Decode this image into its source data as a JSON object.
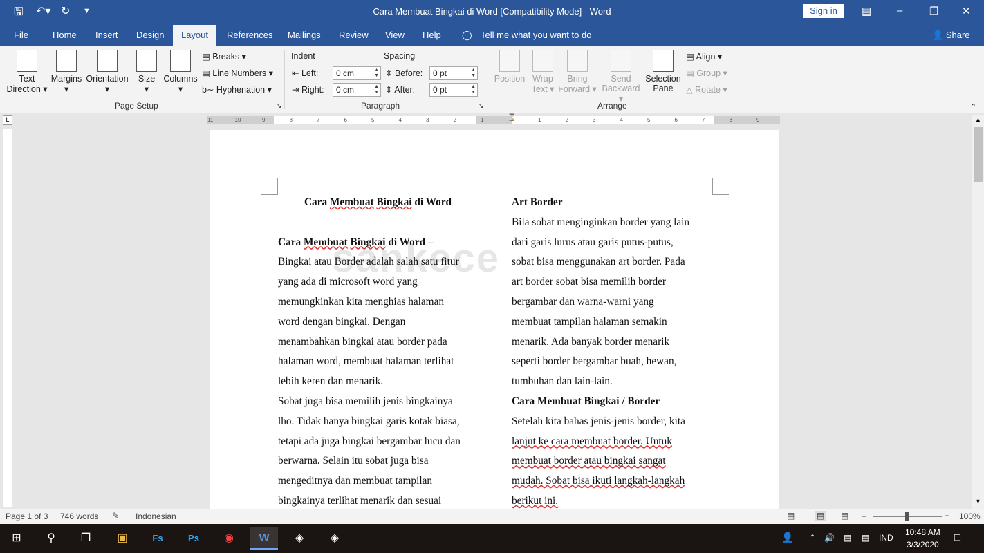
{
  "titlebar": {
    "title": "Cara Membuat Bingkai di Word [Compatibility Mode]  -  Word",
    "signin": "Sign in"
  },
  "menu": {
    "tabs": [
      "File",
      "Home",
      "Insert",
      "Design",
      "Layout",
      "References",
      "Mailings",
      "Review",
      "View",
      "Help"
    ],
    "tellme": "Tell me what you want to do",
    "share": "Share"
  },
  "ribbon": {
    "page_setup": {
      "text_direction": [
        "Text",
        "Direction"
      ],
      "margins": "Margins",
      "orientation": "Orientation",
      "size": "Size",
      "columns": "Columns",
      "breaks": "Breaks",
      "line_numbers": "Line Numbers",
      "hyphenation": "Hyphenation",
      "group": "Page Setup"
    },
    "paragraph": {
      "indent": "Indent",
      "spacing": "Spacing",
      "left_label": "Left:",
      "left_value": "0 cm",
      "right_label": "Right:",
      "right_value": "0 cm",
      "before_label": "Before:",
      "before_value": "0 pt",
      "after_label": "After:",
      "after_value": "0 pt",
      "group": "Paragraph"
    },
    "arrange": {
      "position": "Position",
      "wrap": [
        "Wrap",
        "Text"
      ],
      "bring": [
        "Bring",
        "Forward"
      ],
      "send": [
        "Send",
        "Backward"
      ],
      "selection": [
        "Selection",
        "Pane"
      ],
      "align": "Align",
      "group_btn": "Group",
      "rotate": "Rotate",
      "group": "Arrange"
    }
  },
  "ruler": {
    "labels": [
      "11",
      "10",
      "9",
      "8",
      "7",
      "6",
      "5",
      "4",
      "3",
      "2",
      "1",
      "1",
      "2",
      "3",
      "4",
      "5",
      "6",
      "7",
      "8",
      "9"
    ]
  },
  "doc": {
    "left": {
      "title": [
        "Cara ",
        "Membuat",
        " ",
        "Bingkai",
        " di Word"
      ],
      "lines": [
        [
          "Cara ",
          "Membuat",
          " ",
          "Bingkai",
          " di Word –"
        ],
        "Bingkai atau Border adalah salah satu fitur",
        "yang ada di microsoft word yang",
        "memungkinkan kita menghias halaman",
        "word dengan bingkai. Dengan",
        "menambahkan bingkai atau border pada",
        "halaman word, membuat halaman terlihat",
        "lebih keren dan menarik.",
        "Sobat juga bisa memilih jenis bingkainya",
        "lho. Tidak hanya bingkai garis kotak biasa,",
        "tetapi ada juga bingkai bergambar lucu dan",
        "berwarna. Selain itu sobat juga bisa",
        "mengeditnya dan membuat tampilan",
        "bingkainya terlihat menarik dan sesuai"
      ]
    },
    "right": {
      "heading1": "Art Border",
      "para1": [
        "Bila sobat menginginkan border yang lain",
        "dari garis lurus atau garis putus-putus,",
        "sobat bisa menggunakan art border. Pada",
        "art border sobat bisa memilih border",
        "bergambar dan warna-warni yang",
        "membuat tampilan halaman semakin",
        "menarik. Ada banyak border menarik",
        "seperti border bergambar buah, hewan,",
        "tumbuhan dan lain-lain."
      ],
      "heading2": "Cara Membuat Bingkai / Border",
      "para2": [
        "Setelah kita bahas jenis-jenis border, kita",
        "lanjut ke cara membuat border. Untuk",
        "membuat border atau bingkai sangat",
        "mudah. Sobat bisa ikuti langkah-langkah",
        "berikut ini."
      ]
    },
    "watermark": "sankece"
  },
  "status": {
    "page": "Page 1 of 3",
    "words": "746 words",
    "language": "Indonesian",
    "zoom": "100%"
  },
  "taskbar": {
    "time": "10:48 AM",
    "date": "3/3/2020",
    "lang": "IND"
  }
}
